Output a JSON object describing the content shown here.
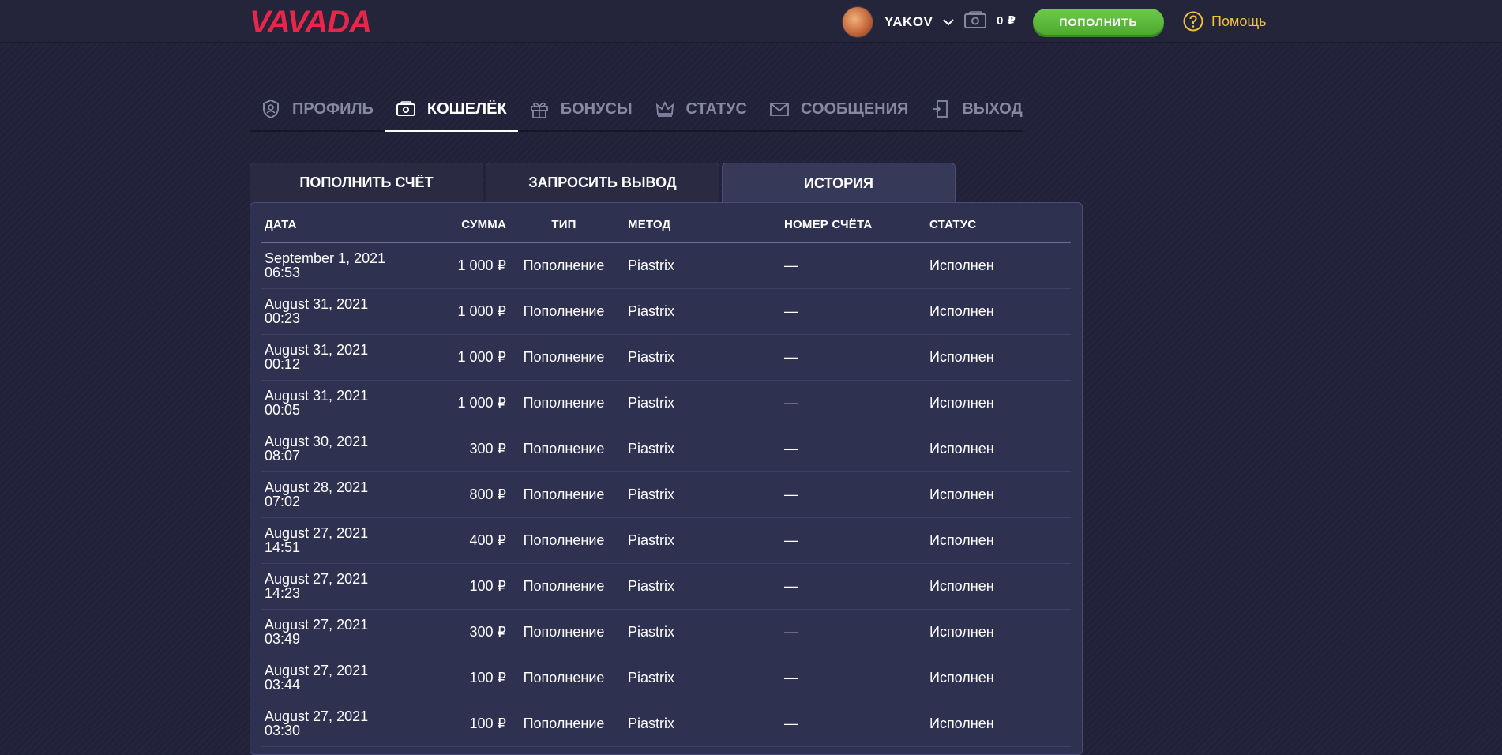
{
  "header": {
    "logo_text": "VAVADA",
    "username": "YAKOV",
    "balance": "0 ₽",
    "deposit_label": "ПОПОЛНИТЬ",
    "help_label": "Помощь"
  },
  "nav": {
    "items": [
      {
        "label": "ПРОФИЛЬ",
        "icon": "shield-icon"
      },
      {
        "label": "КОШЕЛЁК",
        "icon": "wallet-icon",
        "active": true
      },
      {
        "label": "БОНУСЫ",
        "icon": "gift-icon"
      },
      {
        "label": "СТАТУС",
        "icon": "crown-icon"
      },
      {
        "label": "СООБЩЕНИЯ",
        "icon": "envelope-icon"
      },
      {
        "label": "ВЫХОД",
        "icon": "exit-icon"
      }
    ]
  },
  "subtabs": [
    {
      "label": "ПОПОЛНИТЬ СЧЁТ"
    },
    {
      "label": "ЗАПРОСИТЬ ВЫВОД"
    },
    {
      "label": "ИСТОРИЯ",
      "active": true
    }
  ],
  "table": {
    "headers": [
      "ДАТА",
      "СУММА",
      "ТИП",
      "МЕТОД",
      "НОМЕР СЧЁТА",
      "СТАТУС"
    ],
    "rows": [
      {
        "date": "September 1, 2021",
        "time": "06:53",
        "sum": "1 000 ₽",
        "type": "Пополнение",
        "method": "Piastrix",
        "account": "—",
        "status": "Исполнен"
      },
      {
        "date": "August 31, 2021",
        "time": "00:23",
        "sum": "1 000 ₽",
        "type": "Пополнение",
        "method": "Piastrix",
        "account": "—",
        "status": "Исполнен"
      },
      {
        "date": "August 31, 2021",
        "time": "00:12",
        "sum": "1 000 ₽",
        "type": "Пополнение",
        "method": "Piastrix",
        "account": "—",
        "status": "Исполнен"
      },
      {
        "date": "August 31, 2021",
        "time": "00:05",
        "sum": "1 000 ₽",
        "type": "Пополнение",
        "method": "Piastrix",
        "account": "—",
        "status": "Исполнен"
      },
      {
        "date": "August 30, 2021",
        "time": "08:07",
        "sum": "300 ₽",
        "type": "Пополнение",
        "method": "Piastrix",
        "account": "—",
        "status": "Исполнен"
      },
      {
        "date": "August 28, 2021",
        "time": "07:02",
        "sum": "800 ₽",
        "type": "Пополнение",
        "method": "Piastrix",
        "account": "—",
        "status": "Исполнен"
      },
      {
        "date": "August 27, 2021",
        "time": "14:51",
        "sum": "400 ₽",
        "type": "Пополнение",
        "method": "Piastrix",
        "account": "—",
        "status": "Исполнен"
      },
      {
        "date": "August 27, 2021",
        "time": "14:23",
        "sum": "100 ₽",
        "type": "Пополнение",
        "method": "Piastrix",
        "account": "—",
        "status": "Исполнен"
      },
      {
        "date": "August 27, 2021",
        "time": "03:49",
        "sum": "300 ₽",
        "type": "Пополнение",
        "method": "Piastrix",
        "account": "—",
        "status": "Исполнен"
      },
      {
        "date": "August 27, 2021",
        "time": "03:44",
        "sum": "100 ₽",
        "type": "Пополнение",
        "method": "Piastrix",
        "account": "—",
        "status": "Исполнен"
      },
      {
        "date": "August 27, 2021",
        "time": "03:30",
        "sum": "100 ₽",
        "type": "Пополнение",
        "method": "Piastrix",
        "account": "—",
        "status": "Исполнен"
      }
    ]
  },
  "colors": {
    "brand": "#e8264a",
    "accent_green": "#5cb93b",
    "help_yellow": "#f1c232",
    "background": "#21223a"
  }
}
